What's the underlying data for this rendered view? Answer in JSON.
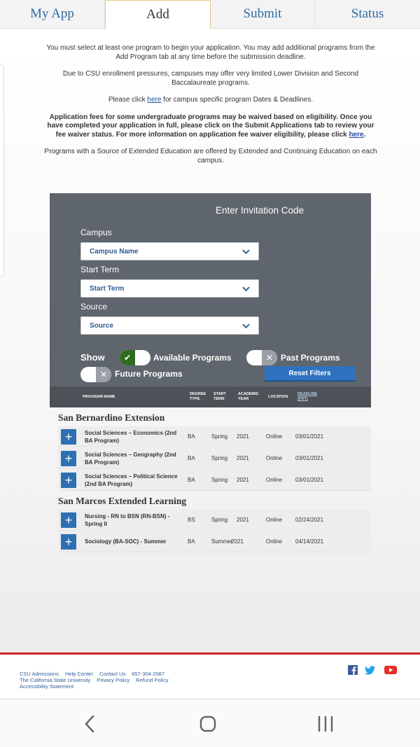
{
  "tabs": [
    {
      "label": "My App"
    },
    {
      "label": "Add"
    },
    {
      "label": "Submit"
    },
    {
      "label": "Status"
    }
  ],
  "intro": {
    "p1": "You must select at least one program to begin your application. You may add additional programs from the Add Program tab at any time before the submission deadline.",
    "p2": "Due to CSU enrollment pressures, campuses may offer very limited Lower Division and Second Baccalaureate programs.",
    "p3_before": "Please click ",
    "p3_link": "here",
    "p3_after": " for campus specific program Dates & Deadlines.",
    "p4_text": "Application fees for some undergraduate programs may be waived based on eligibility. Once you have completed your application in full, please click on the Submit Applications tab to review your fee waiver status. For more information on application fee waiver eligibility, please click ",
    "p4_link": "here",
    "p4_end": ".",
    "p5": "Programs with a Source of Extended Education are offered by Extended and Continuing Education on each campus."
  },
  "filters": {
    "invitation_code": "Enter Invitation Code",
    "campus_label": "Campus",
    "campus_value": "Campus Name",
    "term_label": "Start Term",
    "term_value": "Start Term",
    "source_label": "Source",
    "source_value": "Source",
    "show_label": "Show",
    "available": "Available Programs",
    "past": "Past Programs",
    "future": "Future Programs",
    "reset": "Reset Filters"
  },
  "columns": {
    "program": "PROGRAM NAME",
    "degree1": "DEGREE",
    "degree2": "TYPE",
    "start1": "START",
    "start2": "TERM",
    "year1": "ACADEMIC",
    "year2": "YEAR",
    "location": "LOCATION",
    "deadline1": "DEADLINE",
    "deadline2": "(PDT)"
  },
  "groups": [
    {
      "title": "San Bernardino Extension",
      "rows": [
        {
          "name": "Social Sciences – Economics (2nd BA Program)",
          "degree": "BA",
          "term": "Spring",
          "year": "2021",
          "location": "Online",
          "deadline": "03/01/2021"
        },
        {
          "name": "Social Sciences – Geography (2nd BA Program)",
          "degree": "BA",
          "term": "Spring",
          "year": "2021",
          "location": "Online",
          "deadline": "03/01/2021"
        },
        {
          "name": "Social Sciences – Political Science (2nd BA Program)",
          "degree": "BA",
          "term": "Spring",
          "year": "2021",
          "location": "Online",
          "deadline": "03/01/2021"
        }
      ]
    },
    {
      "title": "San Marcos Extended Learning",
      "rows": [
        {
          "name": "Nursing - RN to BSN (RN-BSN) - Spring II",
          "degree": "BS",
          "term": "Spring",
          "year": "2021",
          "location": "Online",
          "deadline": "02/24/2021"
        },
        {
          "name": "Sociology (BA-SOC) - Summer",
          "degree": "BA",
          "term": "Summer",
          "year": "2021",
          "location": "Online",
          "deadline": "04/14/2021"
        }
      ]
    }
  ],
  "footer": {
    "links_row1": [
      "CSU Admissions",
      "Help Center",
      "Contact Us",
      "857-304-2087"
    ],
    "links_row2": [
      "The California State University",
      "Privacy Policy",
      "Refund Policy"
    ],
    "links_row3": [
      "Accessibility Statement"
    ]
  },
  "colors": {
    "accent": "#2f6aa3",
    "panel": "#5e656c",
    "footer_bar": "#c9252c"
  }
}
